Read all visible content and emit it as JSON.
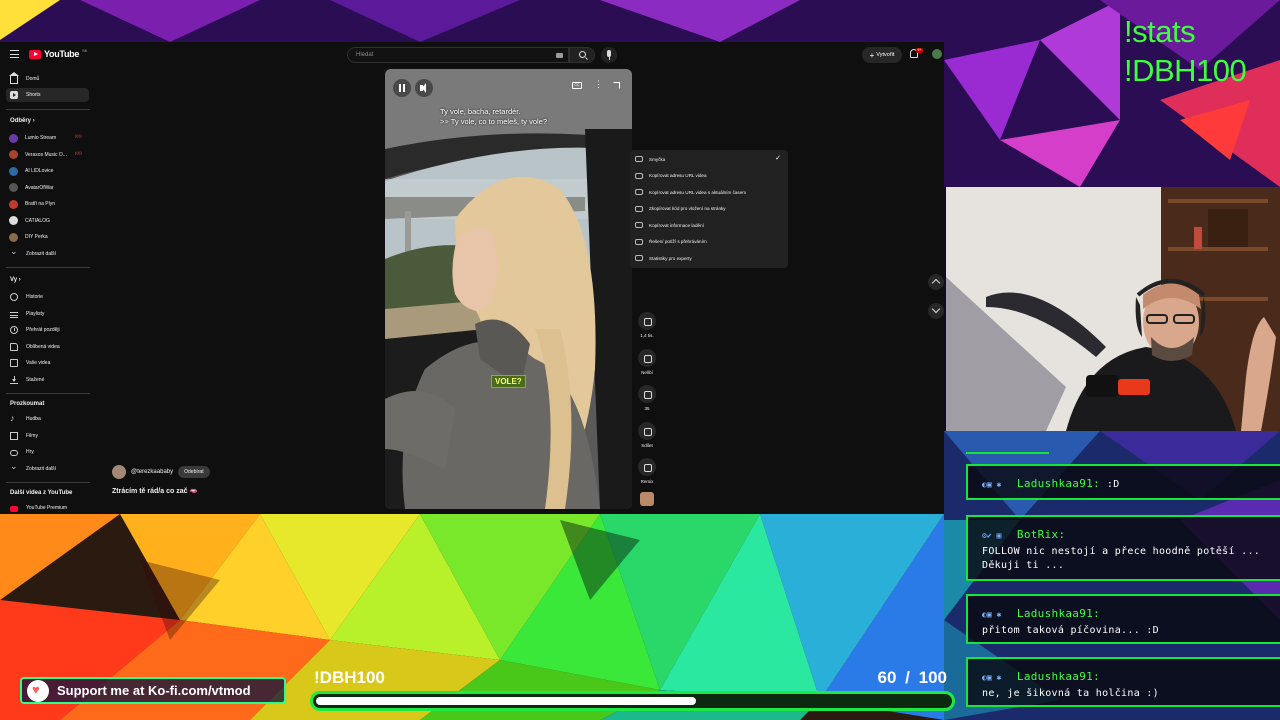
{
  "overlay": {
    "commands": [
      "!stats",
      "!DBH100"
    ],
    "kofi_text": "Support me at Ko-fi.com/vtmod",
    "goal": {
      "name": "!DBH100",
      "current": "60",
      "separator": "/",
      "target": "100",
      "progress": 0.6
    },
    "accent_color": "#1ee843"
  },
  "youtube": {
    "logo_text": "YouTube",
    "logo_region": "SK",
    "search_placeholder": "Hledat",
    "create_label": "Vytvořit",
    "notification_count": "9+",
    "sidebar": {
      "main": [
        {
          "label": "Domů",
          "icon": "home-icon"
        },
        {
          "label": "Shorts",
          "icon": "shorts-icon",
          "active": true
        }
      ],
      "subs_header": "Odběry",
      "subs_arrow": "›",
      "subscriptions": [
        {
          "label": "Lumio Stream",
          "color": "#6b3aa8",
          "live": true
        },
        {
          "label": "Verasos Music O...",
          "color": "#a8442a",
          "live": true
        },
        {
          "label": "AI LIDLovice",
          "color": "#2a6ba8"
        },
        {
          "label": "AvatarOfWar",
          "color": "#555555"
        },
        {
          "label": "Bratři na Plyn",
          "color": "#c23a2a"
        },
        {
          "label": "CATIALOG",
          "color": "#dddddd"
        },
        {
          "label": "DIY Perka",
          "color": "#8a6a4a"
        },
        {
          "label": "Zobrazit další",
          "icon": "chevron-down-icon"
        }
      ],
      "you_header": "Vy",
      "you_arrow": "›",
      "you": [
        {
          "label": "Historie",
          "icon": "history-icon"
        },
        {
          "label": "Playlisty",
          "icon": "playlists-icon"
        },
        {
          "label": "Přehrát později",
          "icon": "watch-later-icon"
        },
        {
          "label": "Oblíbená videa",
          "icon": "liked-videos-icon"
        },
        {
          "label": "Vaše videa",
          "icon": "your-videos-icon"
        },
        {
          "label": "Stažené",
          "icon": "downloads-icon"
        }
      ],
      "explore_header": "Prozkoumat",
      "explore": [
        {
          "label": "Hudba",
          "icon": "music-icon"
        },
        {
          "label": "Filmy",
          "icon": "movies-icon"
        },
        {
          "label": "Hry",
          "icon": "gaming-icon"
        },
        {
          "label": "Zobrazit další",
          "icon": "chevron-down-icon"
        }
      ],
      "more_header": "Další videa z YouTube",
      "more": [
        {
          "label": "YouTube Premium",
          "icon": "youtube-premium-icon"
        }
      ]
    },
    "player": {
      "subtitle_lines": [
        "Ty vole, bacha, retardér.",
        ">> Ty vole, co to meleš, ty vole?"
      ],
      "caption_tag": "VOLE?",
      "cc_label": "CC"
    },
    "context_menu": [
      {
        "label": "Smyčka",
        "icon": "loop-icon",
        "checked": true
      },
      {
        "label": "Kopírovat adresu URL videa",
        "icon": "link-icon"
      },
      {
        "label": "Kopírovat adresu URL videa s aktuálním časem",
        "icon": "link-time-icon"
      },
      {
        "label": "Zkopírovat kód pro vložení na stránky",
        "icon": "embed-icon"
      },
      {
        "label": "Kopírovat informace ladění",
        "icon": "debug-icon"
      },
      {
        "label": "Řešení potíží s přehráváním",
        "icon": "troubleshoot-icon"
      },
      {
        "label": "Statistiky pro experty",
        "icon": "info-icon"
      }
    ],
    "actions": {
      "like_count": "1,4 tis.",
      "dislike_label": "Nelíbí",
      "comment_count": "35",
      "share_label": "Sdílet",
      "remix_label": "Remix"
    },
    "channel": {
      "handle": "@terezkaababy",
      "subscribe_label": "Odebírat",
      "title": "Ztrácím tě rád/a co zač 🫦"
    }
  },
  "chat": {
    "messages": [
      {
        "user": "Ladushkaa91",
        "text": ":D",
        "badges": "◐▣ ✱"
      },
      {
        "user": "BotRix",
        "text": "FOLLOW nic nestojí a přece hoodně potěší ... Děkuji ti ...",
        "badges": "⚙✔ ▣"
      },
      {
        "user": "Ladushkaa91",
        "text": "přitom taková píčovina... :D",
        "badges": "◐▣ ✱"
      },
      {
        "user": "Ladushkaa91",
        "text": "ne, je šikovná ta holčina :)",
        "badges": "◐▣ ✱"
      }
    ]
  }
}
